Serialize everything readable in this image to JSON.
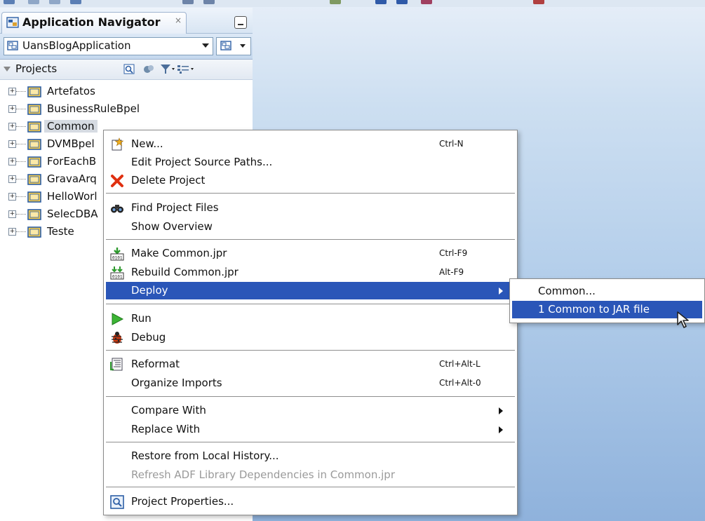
{
  "navigator": {
    "tab_title": "Application Navigator",
    "tab_close": "×",
    "application": "UansBlogApplication",
    "section": "Projects"
  },
  "tree": {
    "items": [
      {
        "label": "Artefatos"
      },
      {
        "label": "BusinessRuleBpel"
      },
      {
        "label": "Common"
      },
      {
        "label": "DVMBpel"
      },
      {
        "label": "ForEachB"
      },
      {
        "label": "GravaArq"
      },
      {
        "label": "HelloWorl"
      },
      {
        "label": "SelecDBA"
      },
      {
        "label": "Teste"
      }
    ],
    "expander_symbol": "+"
  },
  "context_menu": {
    "new": {
      "label": "New...",
      "accel": "Ctrl-N"
    },
    "edit_paths": {
      "label": "Edit Project Source Paths..."
    },
    "delete": {
      "label": "Delete Project"
    },
    "find_files": {
      "label": "Find Project Files"
    },
    "overview": {
      "label": "Show Overview"
    },
    "make": {
      "label": "Make Common.jpr",
      "accel": "Ctrl-F9"
    },
    "rebuild": {
      "label": "Rebuild Common.jpr",
      "accel": "Alt-F9"
    },
    "deploy": {
      "label": "Deploy"
    },
    "run": {
      "label": "Run"
    },
    "debug": {
      "label": "Debug"
    },
    "reformat": {
      "label": "Reformat",
      "accel": "Ctrl+Alt-L"
    },
    "organize": {
      "label": "Organize Imports",
      "accel": "Ctrl+Alt-0"
    },
    "compare": {
      "label": "Compare With"
    },
    "replace": {
      "label": "Replace With"
    },
    "restore": {
      "label": "Restore from Local History..."
    },
    "refresh_adf": {
      "label": "Refresh ADF Library Dependencies in Common.jpr"
    },
    "properties": {
      "label": "Project Properties..."
    }
  },
  "deploy_submenu": {
    "common": {
      "label": "Common..."
    },
    "jar": {
      "label": "1  Common to JAR file"
    }
  },
  "colors": {
    "highlight": "#2a56b8",
    "folder": "#f2c94c",
    "background": "#b2cdea"
  }
}
